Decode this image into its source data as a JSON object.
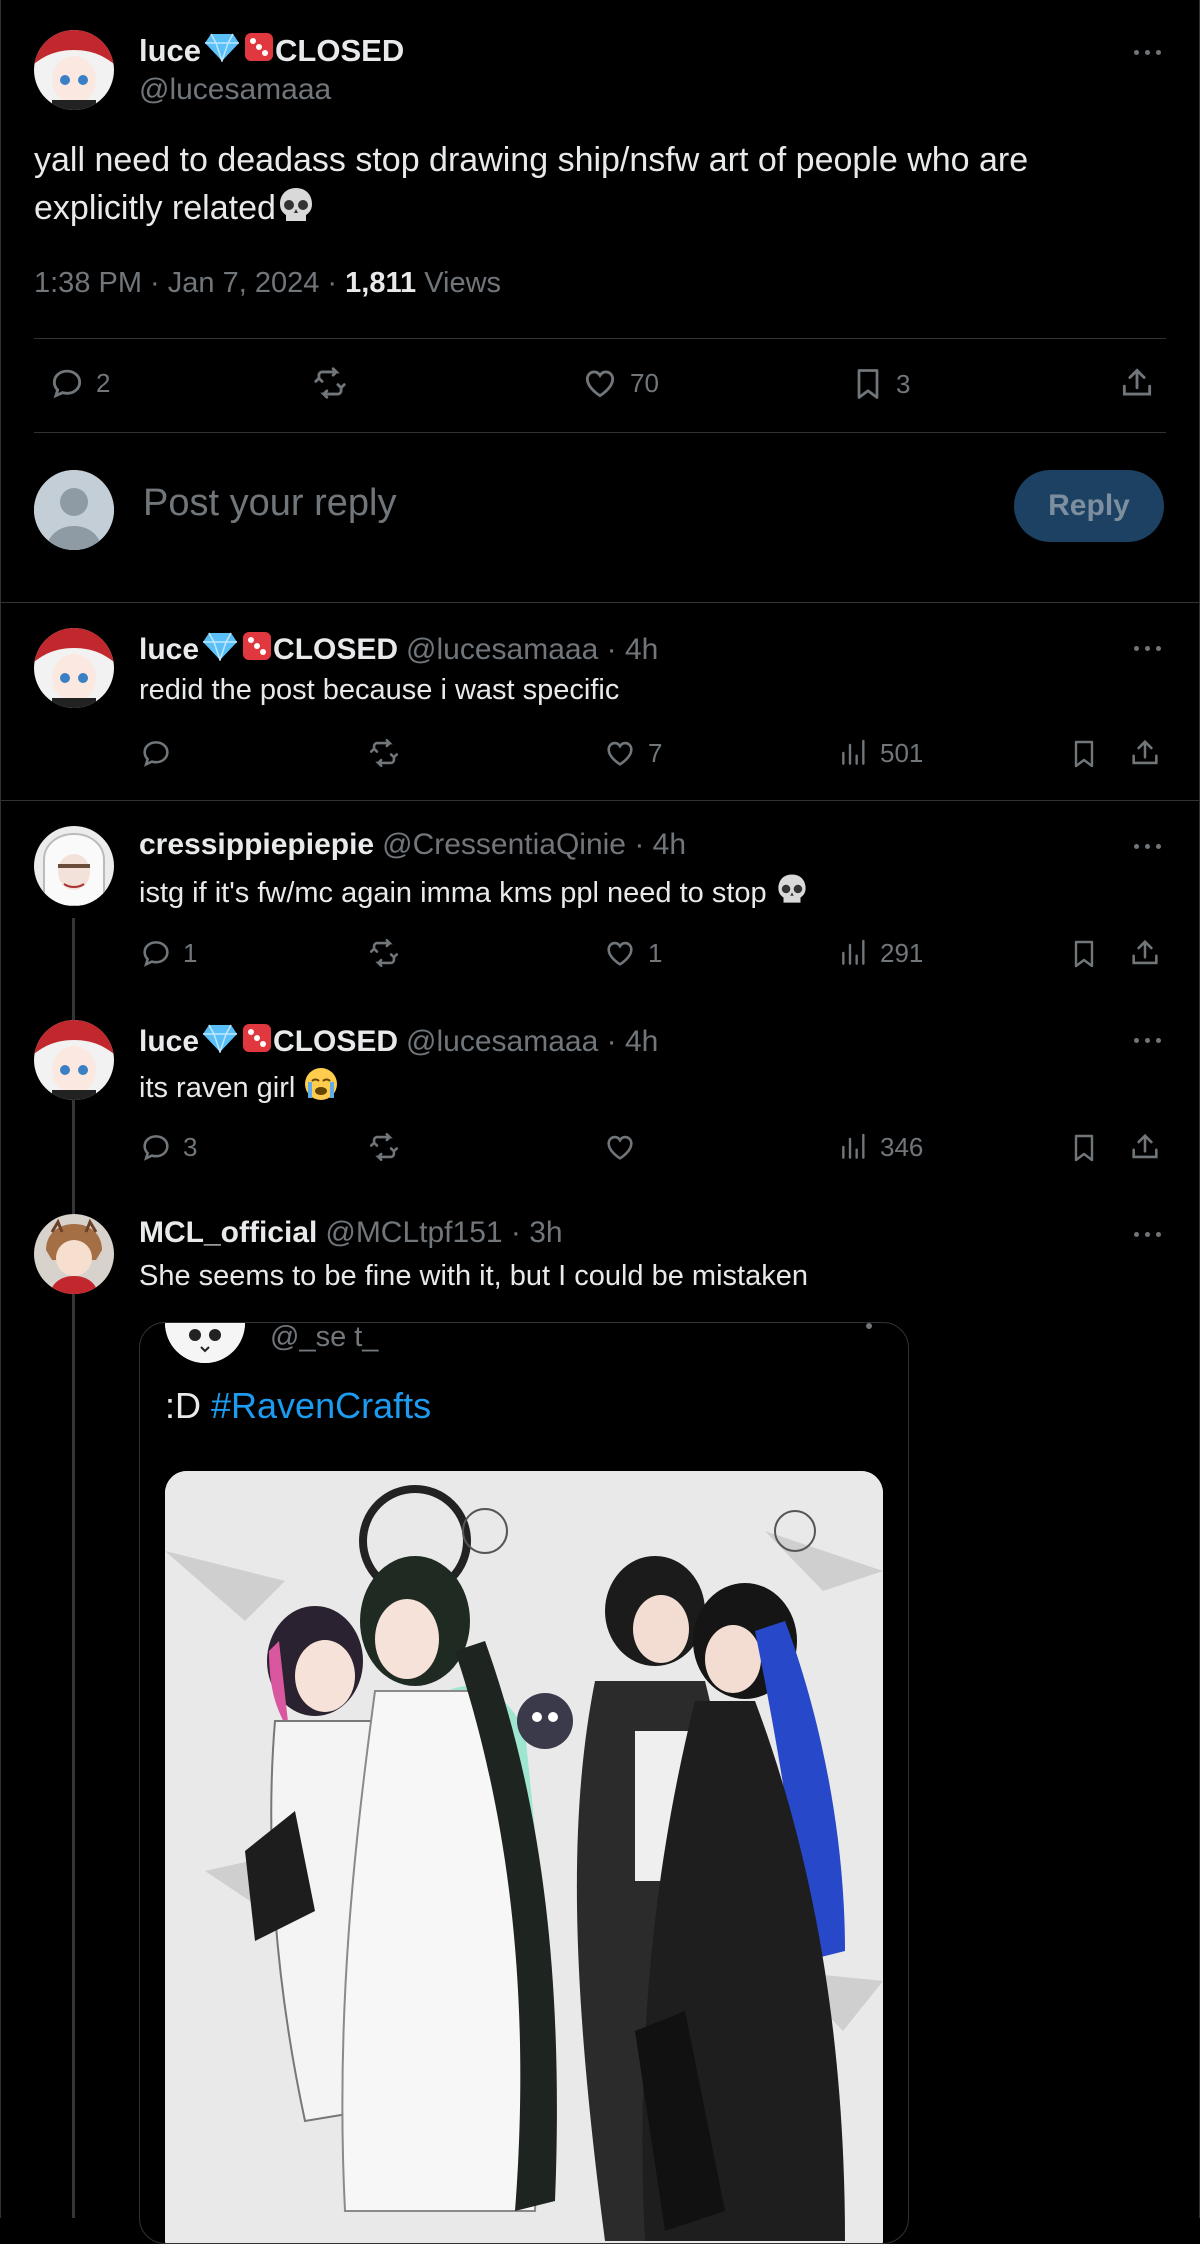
{
  "main_tweet": {
    "name": "luce",
    "status": "CLOSED",
    "handle": "@lucesamaaa",
    "text": "yall need to deadass stop drawing ship/nsfw art of people who are explicitly related",
    "time": "1:38 PM",
    "date": "Jan 7, 2024",
    "views_count": "1,811",
    "views_label": "Views",
    "replies": "2",
    "likes": "70",
    "bookmarks": "3"
  },
  "composer": {
    "placeholder": "Post your reply",
    "button_label": "Reply"
  },
  "replies": [
    {
      "name": "luce",
      "status": "CLOSED",
      "handle": "@lucesamaaa",
      "time": "4h",
      "text": "redid the post because i wast specific",
      "replies": "",
      "likes": "7",
      "views": "501"
    },
    {
      "name": "cressippiepiepie",
      "handle": "@CressentiaQinie",
      "time": "4h",
      "text": "istg if it's fw/mc again imma kms ppl need to stop",
      "replies": "1",
      "likes": "1",
      "views": "291"
    },
    {
      "name": "luce",
      "status": "CLOSED",
      "handle": "@lucesamaaa",
      "time": "4h",
      "text": "its raven girl",
      "replies": "3",
      "likes": "",
      "views": "346"
    },
    {
      "name": "MCL_official",
      "handle": "@MCLtpf151",
      "time": "3h",
      "text": "She seems to be fine with it, but I could be mistaken"
    }
  ],
  "quote": {
    "handle": "@_se t_",
    "text_prefix": ":D ",
    "hashtag": "#RavenCrafts"
  },
  "colors": {
    "background": "#000000",
    "text": "#e7e9ea",
    "muted": "#71767b",
    "border": "#2f3336",
    "accent": "#1d9bf0",
    "reply_button": "#1c4163"
  },
  "icons": [
    "reply-icon",
    "retweet-icon",
    "like-icon",
    "bookmark-icon",
    "share-icon",
    "views-icon",
    "more-icon",
    "gem-emoji",
    "dice-emoji",
    "skull-emoji",
    "crying-emoji"
  ]
}
